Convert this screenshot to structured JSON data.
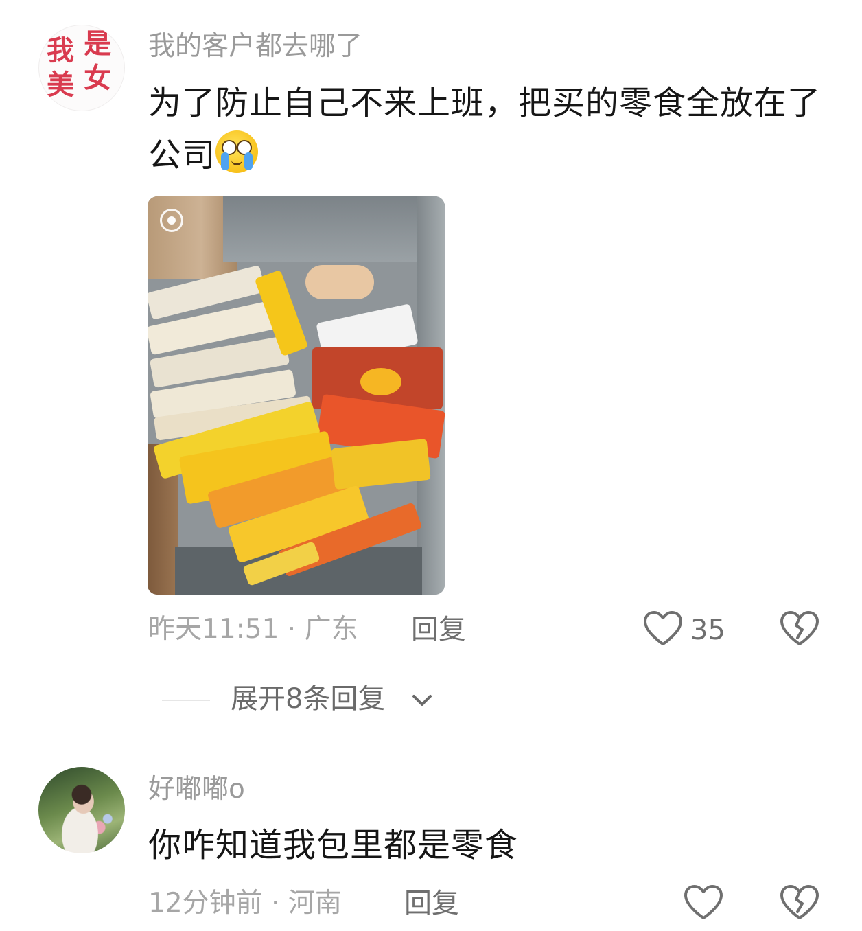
{
  "comments": [
    {
      "avatar_text": [
        "我",
        "是",
        "美",
        "女"
      ],
      "username": "我的客户都去哪了",
      "text": "为了防止自己不来上班，把买的零食全放在了公司",
      "emoji": "crying-face-emoji",
      "image": "snack-drawer-photo",
      "time_location": "昨天11:51 · 广东",
      "reply_label": "回复",
      "like_count": "35",
      "expand_replies": "展开8条回复"
    },
    {
      "username": "好嘟嘟o",
      "text": "你咋知道我包里都是零食",
      "time_location": "12分钟前 · 河南",
      "reply_label": "回复",
      "like_count": ""
    }
  ],
  "colors": {
    "username": "#9a9a9a",
    "text": "#161616",
    "meta": "#a6a6a6",
    "action": "#6f6f6f",
    "avatar_text": "#d93b4f"
  },
  "icons": [
    "heart-icon",
    "broken-heart-icon",
    "chevron-down-icon",
    "live-photo-icon"
  ]
}
